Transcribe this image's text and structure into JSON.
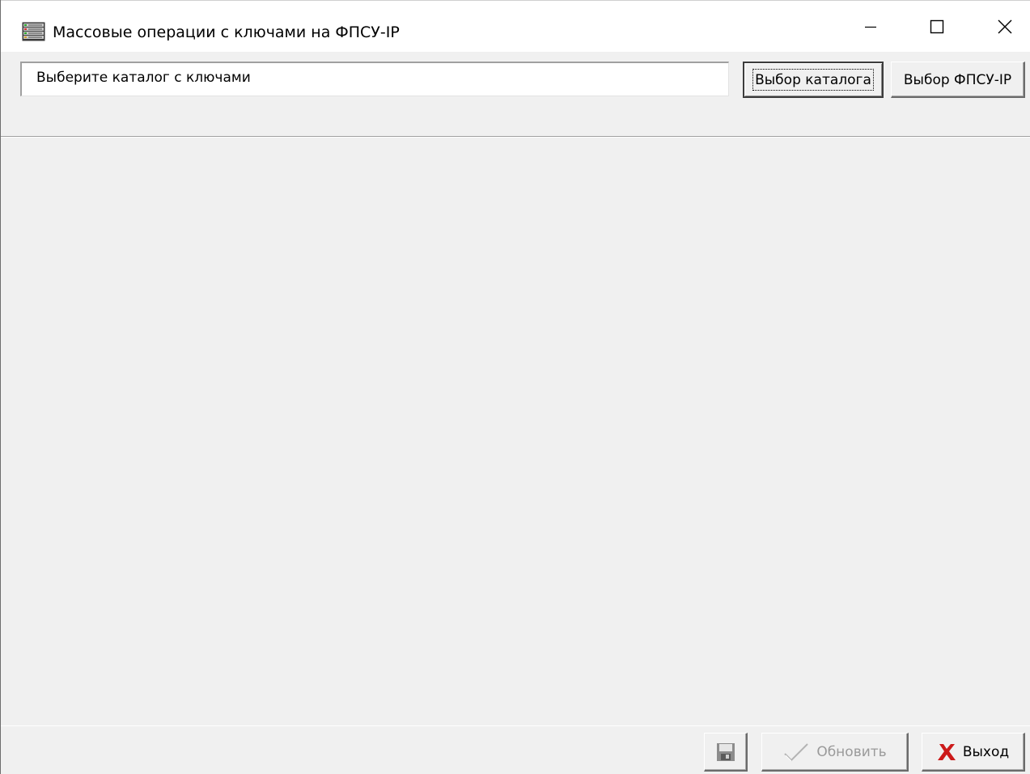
{
  "window": {
    "title": "Массовые операции с  ключами на ФПСУ-IP",
    "icon": "server-rack-icon",
    "controls": {
      "minimize": "minimize-icon",
      "maximize": "maximize-icon",
      "close": "close-icon"
    }
  },
  "toolbar": {
    "path_value": "Выберите каталог с ключами",
    "select_catalog_label": "Выбор каталога",
    "select_fpsu_label": "Выбор ФПСУ-IP"
  },
  "footer": {
    "save_icon": "floppy-disk-icon",
    "refresh_label": "Обновить",
    "refresh_icon": "checkmark-icon",
    "exit_label": "Выход",
    "exit_icon": "red-x-icon"
  },
  "colors": {
    "background": "#f0f0f0",
    "disabled_text": "#9a9a9a",
    "exit_icon": "#cc1a1a"
  }
}
